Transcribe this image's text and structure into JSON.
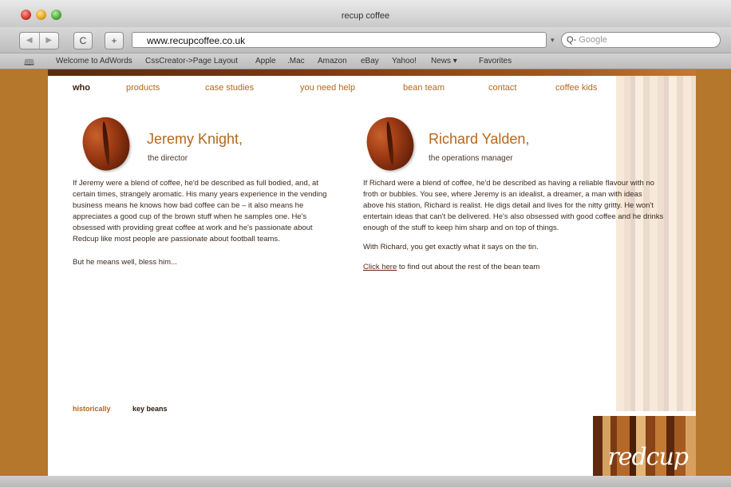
{
  "window": {
    "title": "recup coffee"
  },
  "toolbar": {
    "back": "◀",
    "forward": "▶",
    "reload": "C",
    "add": "+",
    "url": "www.recupcoffee.co.uk",
    "search_placeholder": "Google",
    "search_prefix": "Q-"
  },
  "bookmarks": {
    "items": [
      "Welcome to AdWords",
      "CssCreator->Page Layout",
      "Apple",
      ".Mac",
      "Amazon",
      "eBay",
      "Yahoo!",
      "News ▾",
      "Favorites"
    ]
  },
  "nav": {
    "items": [
      "who",
      "products",
      "case studies",
      "you need help",
      "bean team",
      "contact",
      "coffee kids"
    ],
    "active": "who"
  },
  "people": [
    {
      "name": "Jeremy Knight,",
      "role": "the director",
      "paragraphs": [
        "If Jeremy were a blend of coffee, he'd be described as full bodied, and, at certain times, strangely aromatic. His many years experience in the vending business means he knows how bad coffee can be – it also means he appreciates a good cup of the brown stuff when he samples one. He's obsessed with providing great coffee at work and he's passionate about Redcup like most people are passionate about football teams.",
        "But he means well, bless him..."
      ]
    },
    {
      "name": "Richard Yalden,",
      "role": "the operations manager",
      "paragraphs": [
        "If Richard were a blend of coffee, he'd be described as having a reliable flavour with no froth or bubbles. You see, where Jeremy is an idealist, a dreamer, a man with ideas above his station, Richard is realist. He digs detail and lives for the nitty gritty. He won't entertain ideas that can't be delivered. He's also obsessed with good coffee and he drinks enough of the stuff to keep him sharp and on top of things.",
        "With Richard, you get exactly what it says on the tin."
      ],
      "link_text": "Click here",
      "link_suffix": " to find out about the rest of the bean team"
    }
  ],
  "footer": {
    "link1": "historically",
    "link2": "key beans"
  },
  "logo": {
    "text": "redcup"
  },
  "colors": {
    "accent": "#b4681c",
    "frame": "#b4772b",
    "text": "#3b2a1d"
  }
}
